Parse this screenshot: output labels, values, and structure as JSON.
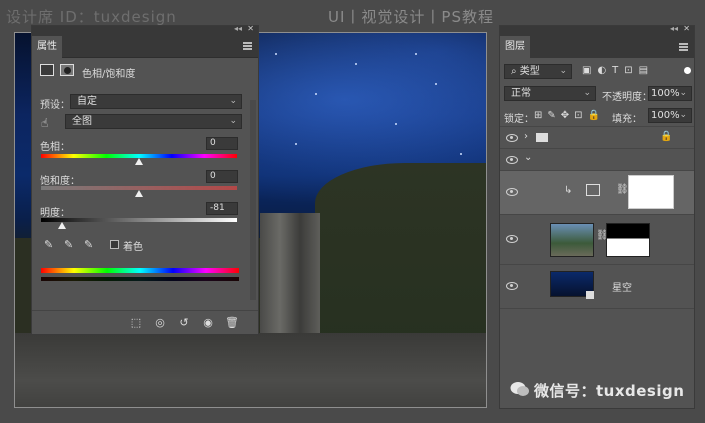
{
  "watermark": {
    "top_left": "设计席 ID：tuxdesign",
    "title": "UI丨视觉设计丨PS教程",
    "wechat": "微信号：tuxdesign"
  },
  "properties": {
    "tab": "属性",
    "type_label": "色相/饱和度",
    "preset_label": "预设：",
    "preset_value": "自定",
    "channel_value": "全图",
    "hue_label": "色相：",
    "hue_value": "0",
    "saturation_label": "饱和度：",
    "saturation_value": "0",
    "lightness_label": "明度：",
    "lightness_value": "-81",
    "colorize_label": "着色",
    "colors": {
      "accent": "#f0f0f0"
    }
  },
  "layers": {
    "tab": "图层",
    "filter_label": "类型",
    "blend_mode": "正常",
    "opacity_label": "不透明度：",
    "opacity_value": "100%",
    "lock_label": "锁定：",
    "fill_label": "填充：",
    "fill_value": "100%",
    "star_layer_name": "星空"
  }
}
